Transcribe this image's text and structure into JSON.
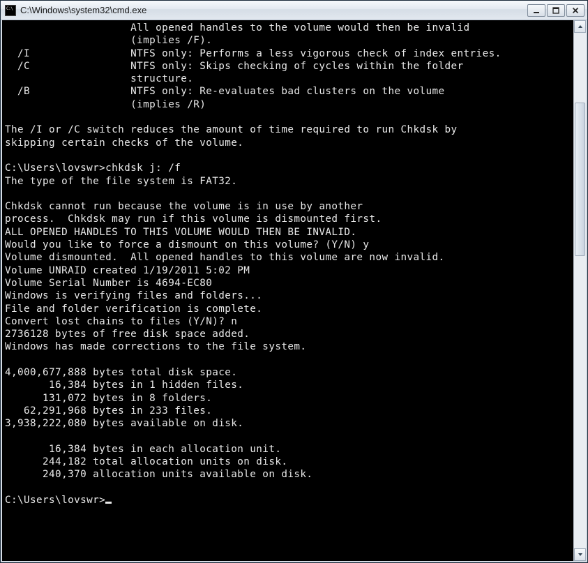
{
  "window": {
    "title": "C:\\Windows\\system32\\cmd.exe"
  },
  "terminal": {
    "prompt_tail": "C:\\Users\\lovswr>",
    "lines": [
      "                    All opened handles to the volume would then be invalid",
      "                    (implies /F).",
      "  /I                NTFS only: Performs a less vigorous check of index entries.",
      "  /C                NTFS only: Skips checking of cycles within the folder",
      "                    structure.",
      "  /B                NTFS only: Re-evaluates bad clusters on the volume",
      "                    (implies /R)",
      "",
      "The /I or /C switch reduces the amount of time required to run Chkdsk by",
      "skipping certain checks of the volume.",
      "",
      "C:\\Users\\lovswr>chkdsk j: /f",
      "The type of the file system is FAT32.",
      "",
      "Chkdsk cannot run because the volume is in use by another",
      "process.  Chkdsk may run if this volume is dismounted first.",
      "ALL OPENED HANDLES TO THIS VOLUME WOULD THEN BE INVALID.",
      "Would you like to force a dismount on this volume? (Y/N) y",
      "Volume dismounted.  All opened handles to this volume are now invalid.",
      "Volume UNRAID created 1/19/2011 5:02 PM",
      "Volume Serial Number is 4694-EC80",
      "Windows is verifying files and folders...",
      "File and folder verification is complete.",
      "Convert lost chains to files (Y/N)? n",
      "2736128 bytes of free disk space added.",
      "Windows has made corrections to the file system.",
      "",
      "4,000,677,888 bytes total disk space.",
      "       16,384 bytes in 1 hidden files.",
      "      131,072 bytes in 8 folders.",
      "   62,291,968 bytes in 233 files.",
      "3,938,222,080 bytes available on disk.",
      "",
      "       16,384 bytes in each allocation unit.",
      "      244,182 total allocation units on disk.",
      "      240,370 allocation units available on disk.",
      ""
    ]
  }
}
